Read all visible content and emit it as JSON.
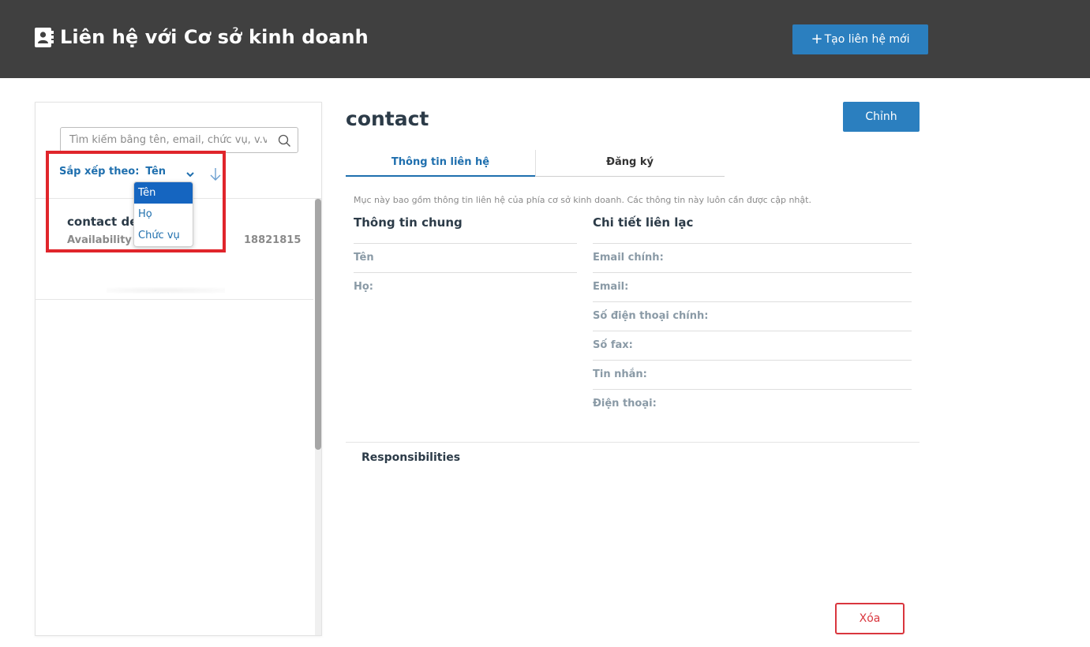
{
  "header": {
    "title": "Liên hệ với Cơ sở kinh doanh",
    "new_contact_label": "Tạo liên hệ mới",
    "plus_symbol": "+"
  },
  "sidebar": {
    "search_placeholder": "Tìm kiếm bằng tên, email, chức vụ, v.v.",
    "sort_label": "Sắp xếp theo:",
    "sort_value": "Tên",
    "sort_options": [
      "Tên",
      "Họ",
      "Chức vụ"
    ],
    "contacts": [
      {
        "name": "contact dea",
        "subtitle": "Availability M",
        "phone": "18821815"
      }
    ]
  },
  "detail": {
    "title": "contact",
    "edit_label": "Chỉnh",
    "tabs": [
      {
        "label": "Thông tin liên hệ",
        "active": true
      },
      {
        "label": "Đăng ký",
        "active": false
      }
    ],
    "description": "Mục này bao gồm thông tin liên hệ của phía cơ sở kinh doanh. Các thông tin này luôn cần được cập nhật.",
    "general": {
      "title": "Thông tin chung",
      "fields": [
        "Tên",
        "Họ:"
      ]
    },
    "contact_details": {
      "title": "Chi tiết liên lạc",
      "fields": [
        "Email chính:",
        "Email:",
        "Số điện thoại chính:",
        "Số fax:",
        "Tin nhắn:",
        "Điện thoại:"
      ]
    },
    "responsibilities_title": "Responsibilities",
    "delete_label": "Xóa"
  },
  "colors": {
    "header_bg": "#404040",
    "accent_blue": "#2b7fbf",
    "link_blue": "#1f6fae",
    "delete_red": "#d9363e",
    "highlight_red": "#e0252b"
  },
  "icons": {
    "header": "contact-book-icon",
    "search": "search-icon",
    "sort_chevron": "chevron-down-icon",
    "sort_direction": "arrow-down-icon"
  }
}
